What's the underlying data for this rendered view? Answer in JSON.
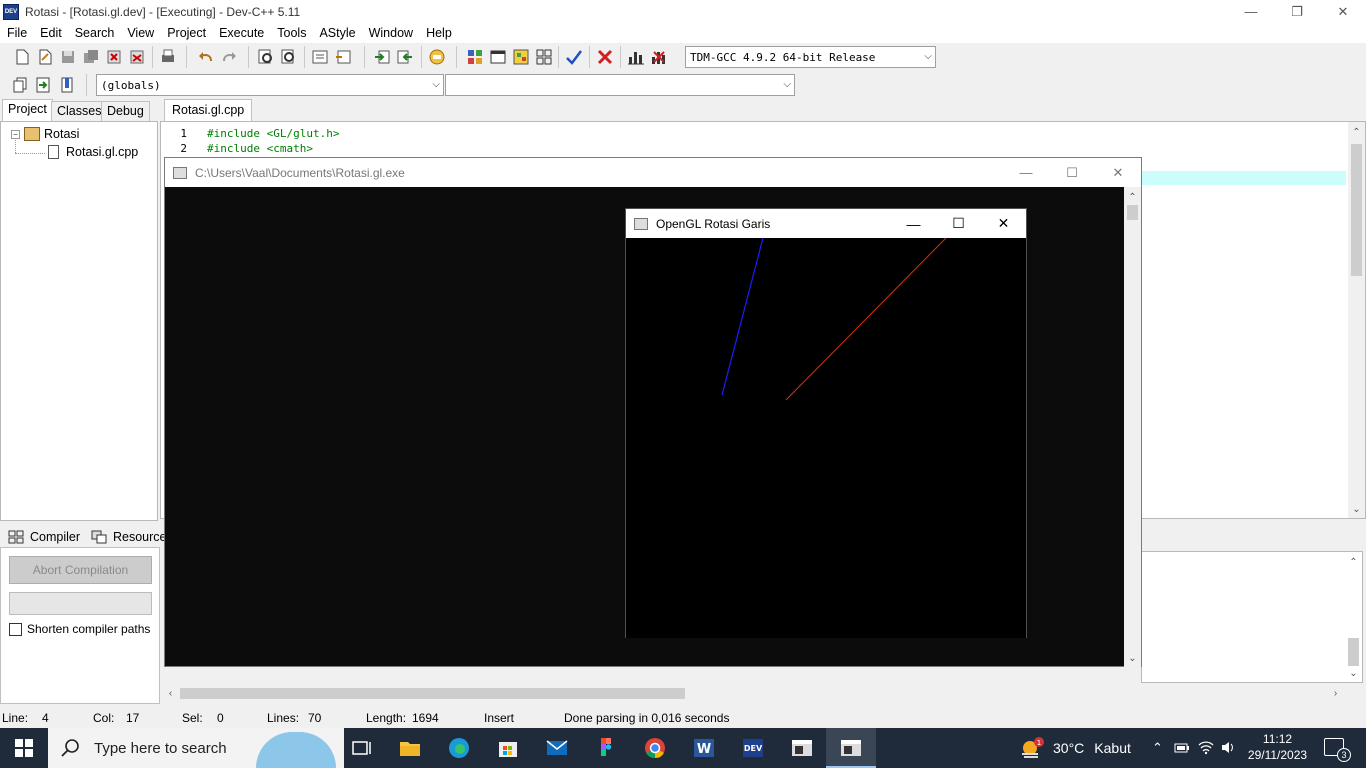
{
  "window": {
    "title": "Rotasi - [Rotasi.gl.dev] - [Executing] - Dev-C++ 5.11"
  },
  "menu": [
    "File",
    "Edit",
    "Search",
    "View",
    "Project",
    "Execute",
    "Tools",
    "AStyle",
    "Window",
    "Help"
  ],
  "toolbar": {
    "compiler_select": "TDM-GCC 4.9.2 64-bit Release",
    "scope_select": "(globals)",
    "member_select": ""
  },
  "left_tabs": [
    "Project",
    "Classes",
    "Debug"
  ],
  "project_tree": {
    "root": "Rotasi",
    "child": "Rotasi.gl.cpp"
  },
  "editor": {
    "tab": "Rotasi.gl.cpp",
    "lines": [
      {
        "num": "1",
        "code": "#include <GL/glut.h>"
      },
      {
        "num": "2",
        "code": "#include <cmath>"
      }
    ]
  },
  "bottom_tabs": {
    "compiler": "Compiler",
    "resources": "Resources"
  },
  "compiler_pane": {
    "abort_label": "Abort Compilation",
    "shorten_label": "Shorten compiler paths"
  },
  "status": {
    "line_label": "Line:",
    "line": "4",
    "col_label": "Col:",
    "col": "17",
    "sel_label": "Sel:",
    "sel": "0",
    "lines_label": "Lines:",
    "lines": "70",
    "length_label": "Length:",
    "length": "1694",
    "mode": "Insert",
    "message": "Done parsing in 0,016 seconds"
  },
  "console": {
    "title": "C:\\Users\\Vaal\\Documents\\Rotasi.gl.exe"
  },
  "opengl": {
    "title": "OpenGL Rotasi Garis",
    "colors": {
      "blue_line": "#1c1cff",
      "red_line": "#e03010"
    }
  },
  "taskbar": {
    "search_placeholder": "Type here to search",
    "weather_temp": "30°C",
    "weather_desc": "Kabut",
    "time": "11:12",
    "date": "29/11/2023",
    "notifications": "3"
  }
}
